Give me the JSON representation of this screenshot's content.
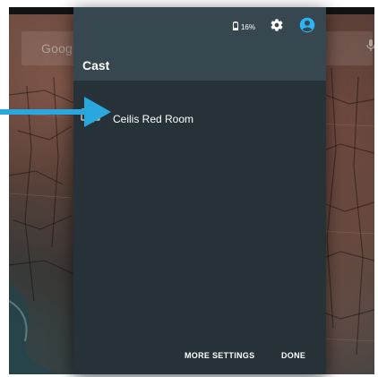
{
  "launcher": {
    "search_text": "Google",
    "search_icon": "google-search-icon",
    "mic_icon": "microphone-icon"
  },
  "status_bar": {
    "battery_icon": "battery-icon",
    "battery_level": "16%",
    "settings_icon": "gear-icon",
    "account_icon": "account-circle-icon"
  },
  "dialog": {
    "title": "Cast",
    "routes": [
      {
        "label": "Ceilis Red Room",
        "icon": "tv-icon"
      }
    ],
    "buttons": {
      "more_settings": "MORE SETTINGS",
      "done": "DONE"
    }
  },
  "annotation": {
    "arrow_color": "#29a8e0",
    "accent_color": "#29b6f6"
  },
  "colors": {
    "dialog_bg": "#263238",
    "header_bg": "#37474f",
    "text": "#ffffff"
  }
}
